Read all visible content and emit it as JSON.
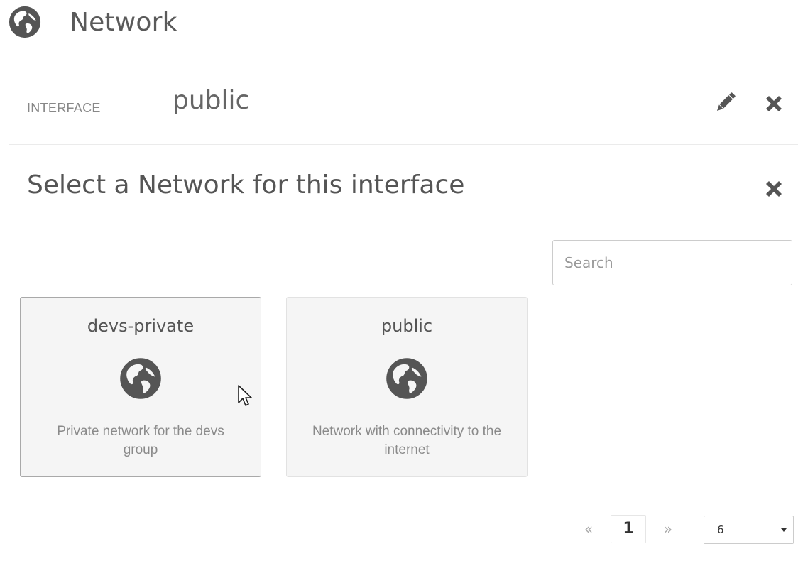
{
  "header": {
    "title": "Network",
    "icon": "globe-icon"
  },
  "interface": {
    "label": "INTERFACE",
    "value": "public",
    "edit_icon": "pencil-icon",
    "close_icon": "close-icon"
  },
  "select_panel": {
    "title": "Select a Network for this interface",
    "close_icon": "close-icon",
    "search": {
      "placeholder": "Search",
      "value": ""
    },
    "networks": [
      {
        "name": "devs-private",
        "icon": "globe-icon",
        "description": "Private network for the devs group",
        "selected": true
      },
      {
        "name": "public",
        "icon": "globe-icon",
        "description": "Network with connectivity to the internet",
        "selected": false
      }
    ]
  },
  "pagination": {
    "prev": "«",
    "current_page": "1",
    "next": "»",
    "page_size": "6"
  },
  "colors": {
    "icon": "#555555",
    "card_bg": "#f5f5f5",
    "text_muted": "#8a8a8a"
  }
}
